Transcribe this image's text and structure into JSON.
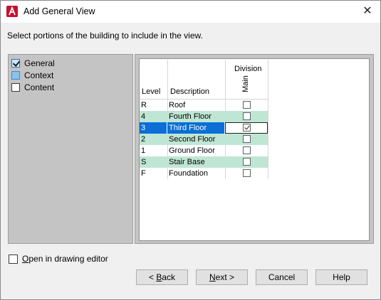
{
  "window": {
    "title": "Add General View"
  },
  "instruction": "Select portions of the building to include in the view.",
  "tree": [
    {
      "label": "General",
      "checked": true,
      "style": "blue"
    },
    {
      "label": "Context",
      "checked": false,
      "style": "blue"
    },
    {
      "label": "Content",
      "checked": false,
      "style": "plain"
    }
  ],
  "grid": {
    "group_header": "Division",
    "col_level": "Level",
    "col_description": "Description",
    "col_main": "Main",
    "rows": [
      {
        "level": "R",
        "description": "Roof",
        "main": false
      },
      {
        "level": "4",
        "description": "Fourth Floor",
        "main": false
      },
      {
        "level": "3",
        "description": "Third Floor",
        "main": true
      },
      {
        "level": "2",
        "description": "Second Floor",
        "main": false
      },
      {
        "level": "1",
        "description": "Ground Floor",
        "main": false
      },
      {
        "level": "S",
        "description": "Stair Base",
        "main": false
      },
      {
        "level": "F",
        "description": "Foundation",
        "main": false
      }
    ]
  },
  "open_in_editor": {
    "label_mnemonic": "O",
    "label_rest": "pen in drawing editor",
    "checked": false
  },
  "buttons": {
    "back": {
      "prefix": "< ",
      "mnemonic": "B",
      "rest": "ack"
    },
    "next": {
      "mnemonic": "N",
      "rest": "ext >"
    },
    "cancel": "Cancel",
    "help": "Help"
  }
}
